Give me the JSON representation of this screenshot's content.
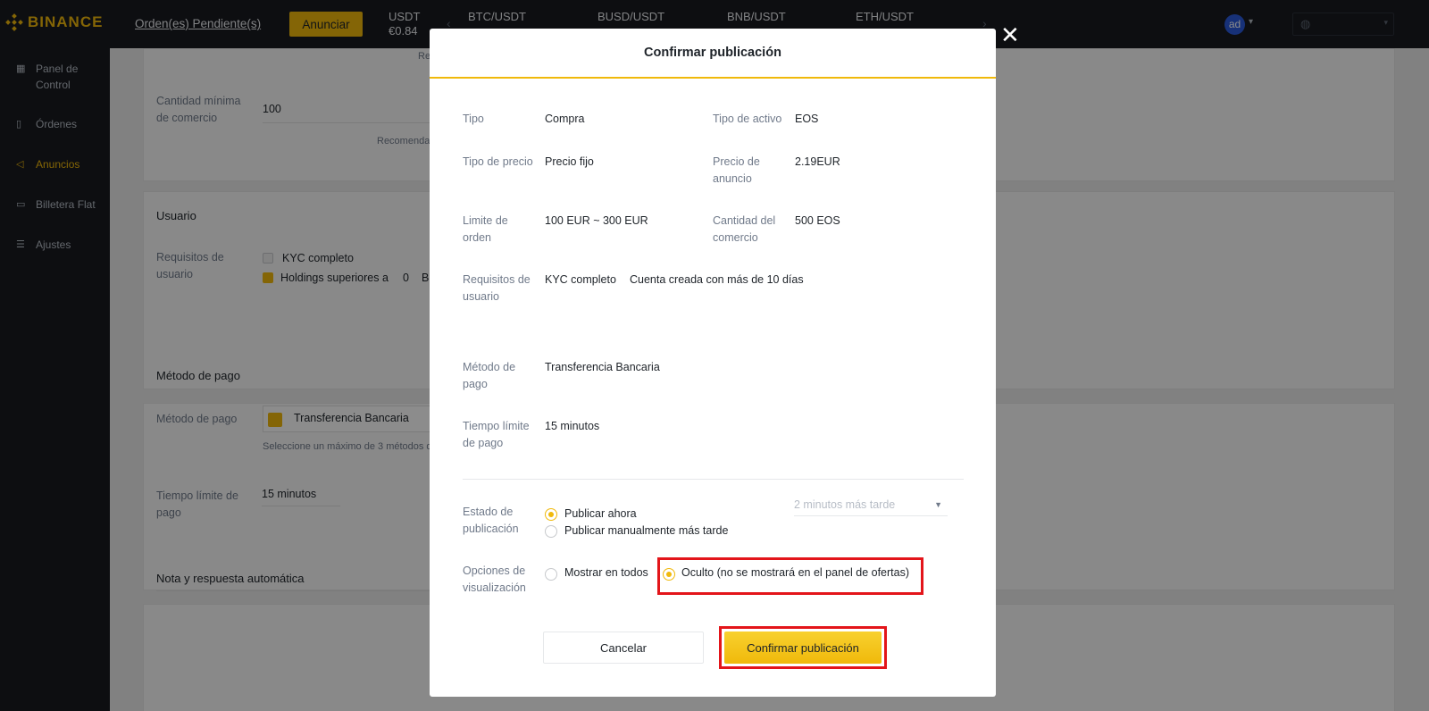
{
  "topbar": {
    "logo_text": "BINANCE",
    "pending_orders": "Orden(es) Pendiente(s)",
    "anunciar_button": "Anunciar",
    "usdt_label": "USDT",
    "usdt_value": "€0.84",
    "tickers": [
      "BTC/USDT",
      "BUSD/USDT",
      "BNB/USDT",
      "ETH/USDT"
    ],
    "avatar_initials": "ad",
    "lang_icon": "globe-icon"
  },
  "sidebar": {
    "items": [
      {
        "label": "Panel de Control",
        "icon": "grid-icon"
      },
      {
        "label": "Órdenes",
        "icon": "document-icon"
      },
      {
        "label": "Anuncios",
        "icon": "megaphone-icon"
      },
      {
        "label": "Billetera Flat",
        "icon": "wallet-icon"
      },
      {
        "label": "Ajustes",
        "icon": "sliders-icon"
      }
    ]
  },
  "background": {
    "cantidad_minima_label": "Cantidad mínima de comercio",
    "cantidad_minima_value": "100",
    "recomendado_text": "Recomenda",
    "re_text": "Re",
    "usuario_title": "Usuario",
    "requisitos_label": "Requisitos de usuario",
    "kyc_label": "KYC completo",
    "holdings_label": "Holdings superiores a",
    "holdings_value": "0",
    "holdings_unit": "B",
    "metodo_title": "Método de pago",
    "metodo_label": "Método de pago",
    "metodo_tag": "Transferencia Bancaria",
    "metodo_hint": "Seleccione un máximo de 3 métodos d",
    "tiempo_label": "Tiempo límite de pago",
    "tiempo_value": "15 minutos",
    "nota_title": "Nota y respuesta automática"
  },
  "modal": {
    "title": "Confirmar publicación",
    "rows": {
      "tipo_label": "Tipo",
      "tipo_value": "Compra",
      "tipo_activo_label": "Tipo de activo",
      "tipo_activo_value": "EOS",
      "tipo_precio_label": "Tipo de precio",
      "tipo_precio_value": "Precio fijo",
      "precio_anuncio_label": "Precio de anuncio",
      "precio_anuncio_value": "2.19EUR",
      "limite_label": "Limite de orden",
      "limite_value": "100 EUR ~ 300 EUR",
      "cantidad_label": "Cantidad del comercio",
      "cantidad_value": "500 EOS",
      "requisitos_label": "Requisitos de usuario",
      "requisito_1": "KYC completo",
      "requisito_2": "Cuenta creada con más de 10 días",
      "metodo_label": "Método de pago",
      "metodo_value": "Transferencia Bancaria",
      "tiempo_label": "Tiempo límite de pago",
      "tiempo_value": "15 minutos"
    },
    "estado": {
      "label": "Estado de publicación",
      "option_now": "Publicar ahora",
      "option_later": "Publicar manualmente más tarde",
      "schedule_placeholder": "2 minutos más tarde",
      "selected": "Publicar ahora"
    },
    "visualizacion": {
      "label": "Opciones de visualización",
      "option_all": "Mostrar en todos",
      "option_hidden": "Oculto (no se mostrará en el panel de ofertas)",
      "selected": "Oculto (no se mostrará en el panel de ofertas)"
    },
    "cancel_button": "Cancelar",
    "confirm_button": "Confirmar publicación"
  },
  "colors": {
    "brand": "#f0b90b",
    "highlight": "#e3151a",
    "dark": "#181a20"
  }
}
